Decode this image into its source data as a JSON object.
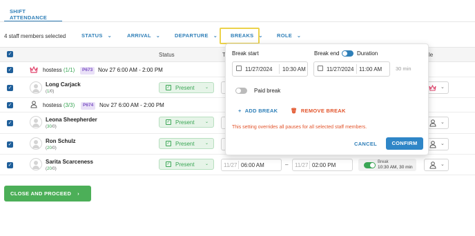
{
  "tab": "SHIFT ATTENDANCE",
  "toolbar": {
    "selected_text": "4 staff members selected",
    "filters": [
      "STATUS",
      "ARRIVAL",
      "DEPARTURE",
      "BREAKS",
      "ROLE"
    ]
  },
  "table": {
    "status_header": "Status",
    "col_partial_header": "T",
    "role_header_partial": "le"
  },
  "groups": [
    {
      "role": "hostess",
      "count": "(1/1)",
      "id": "P673",
      "shift": "Nov 27 6:00 AM - 2:00 PM"
    },
    {
      "role": "hostess",
      "count": "(3/3)",
      "id": "P674",
      "shift": "Nov 27 6:00 AM - 2:00 PM"
    }
  ],
  "staff": [
    {
      "name": "Long Carjack",
      "stats_a": "1",
      "stats_b": "/0)",
      "status": "Present"
    },
    {
      "name": "Leona Sheepherder",
      "stats_a": "30",
      "stats_b": "/0)",
      "status": "Present"
    },
    {
      "name": "Ron Schulz",
      "stats_a": "20",
      "stats_b": "/0)",
      "status": "Present"
    },
    {
      "name": "Sarita Scarceness",
      "stats_a": "20",
      "stats_b": "/0)",
      "status": "Present"
    }
  ],
  "last_row": {
    "arrival_date": "11/27",
    "arrival_time": "06:00 AM",
    "dash": "–",
    "departure_date": "11/27",
    "departure_time": "02:00 PM",
    "break_label": "Break",
    "break_value": "10:30 AM, 30 min"
  },
  "popover": {
    "break_start_label": "Break start",
    "break_end_label": "Break end",
    "duration_label": "Duration",
    "start_date": "11/27/2024",
    "start_time": "10:30 AM",
    "end_date": "11/27/2024",
    "end_time": "11:00 AM",
    "duration_value": "30 min",
    "paid_break_label": "Paid break",
    "add_break": "ADD BREAK",
    "remove_break": "REMOVE BREAK",
    "warning": "This setting overrides all pauses for all selected staff members.",
    "cancel": "CANCEL",
    "confirm": "CONFIRM"
  },
  "close_button": "CLOSE AND PROCEED",
  "colors": {
    "primary": "#2f7fb8",
    "present_green": "#3aa655",
    "danger": "#e2542b",
    "crown": "#e0426b",
    "proceed_green": "#4caf58",
    "highlight": "#ecd24a"
  }
}
